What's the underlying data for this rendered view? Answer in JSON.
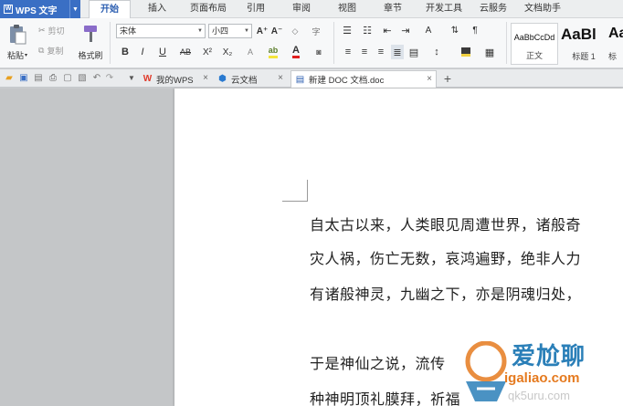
{
  "app": {
    "name": "WPS 文字",
    "logo_letter": "W"
  },
  "menu_tabs": [
    {
      "label": "开始",
      "active": true
    },
    {
      "label": "插入"
    },
    {
      "label": "页面布局"
    },
    {
      "label": "引用"
    },
    {
      "label": "审阅"
    },
    {
      "label": "视图"
    },
    {
      "label": "章节"
    },
    {
      "label": "开发工具"
    },
    {
      "label": "云服务"
    },
    {
      "label": "文档助手"
    }
  ],
  "ribbon": {
    "paste_label": "粘贴",
    "cut_label": "剪切",
    "copy_label": "复制",
    "format_painter_label": "格式刷",
    "font_name": "宋体",
    "font_size": "小四",
    "bold": "B",
    "italic": "I",
    "underline": "U",
    "strikethrough": "AB",
    "superscript": "X²",
    "subscript": "X₂",
    "grow_font": "A⁺",
    "shrink_font": "A⁻",
    "clear_format": "A",
    "font_color": "A",
    "highlight_color_hex": "#f4e43a",
    "font_color_hex": "#e02020",
    "styles": [
      {
        "sample": "AaBbCcDd",
        "name": "正文"
      },
      {
        "sample": "AaBl",
        "name": "标题 1"
      },
      {
        "sample": "Aa",
        "name": "标"
      }
    ]
  },
  "doc_tabs": [
    {
      "label": "我的WPS",
      "icon": "wps-logo-icon"
    },
    {
      "label": "云文档",
      "icon": "cloud-cube-icon"
    },
    {
      "label": "新建 DOC 文档.doc",
      "icon": "doc-file-icon",
      "active": true
    }
  ],
  "document": {
    "paragraphs": [
      "自太古以来，人类眼见周遭世界，诸般奇",
      "灾人祸，伤亡无数，哀鸿遍野，绝非人力",
      "有诸般神灵，九幽之下，亦是阴魂归处，",
      "于是神仙之说，流传",
      "种神明顶礼膜拜，祈福"
    ]
  },
  "watermark": {
    "brand": "爱尬聊",
    "url": "igaliao.com",
    "faint_text": "qk5uru.com"
  }
}
